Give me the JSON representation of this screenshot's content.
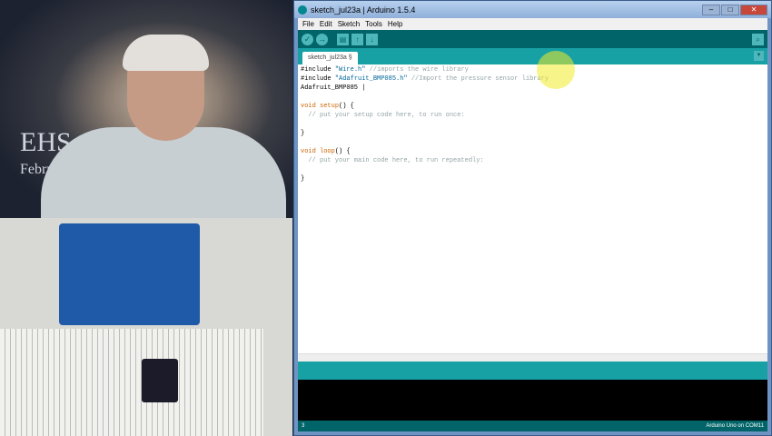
{
  "video": {
    "backdrop_text_1": "EHS",
    "backdrop_text_2": "Febru"
  },
  "window": {
    "title": "sketch_jul23a | Arduino 1.5.4",
    "minimize": "–",
    "maximize": "□",
    "close": "✕"
  },
  "menu": [
    "File",
    "Edit",
    "Sketch",
    "Tools",
    "Help"
  ],
  "toolbar": {
    "verify": "✓",
    "upload": "→",
    "new": "▤",
    "open": "↑",
    "save": "↓",
    "serial_monitor": "⌕"
  },
  "tab": {
    "label": "sketch_jul23a §",
    "menu": "▼"
  },
  "code": [
    [
      {
        "t": "#include ",
        "c": ""
      },
      {
        "t": "\"Wire.h\"",
        "c": "str"
      },
      {
        "t": " //imports the wire library",
        "c": "cm"
      }
    ],
    [
      {
        "t": "#include ",
        "c": ""
      },
      {
        "t": "\"Adafruit_BMP085.h\"",
        "c": "str"
      },
      {
        "t": " //Import the pressure sensor library",
        "c": "cm"
      }
    ],
    [
      {
        "t": "Adafruit_BMP085 |",
        "c": ""
      }
    ],
    [],
    [
      {
        "t": "void ",
        "c": "kw"
      },
      {
        "t": "setup",
        "c": "kw"
      },
      {
        "t": "() {",
        "c": ""
      }
    ],
    [
      {
        "t": "  // put your setup code here, to run once:",
        "c": "cm"
      }
    ],
    [],
    [
      {
        "t": "}",
        "c": ""
      }
    ],
    [],
    [
      {
        "t": "void ",
        "c": "kw"
      },
      {
        "t": "loop",
        "c": "kw"
      },
      {
        "t": "() {",
        "c": ""
      }
    ],
    [
      {
        "t": "  // put your main code here, to run repeatedly:",
        "c": "cm"
      }
    ],
    [],
    [
      {
        "t": "}",
        "c": ""
      }
    ]
  ],
  "status": {
    "line": "3",
    "board": "Arduino Uno on COM11"
  }
}
